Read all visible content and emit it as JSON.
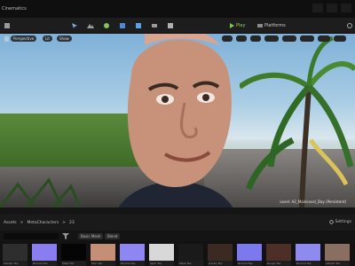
{
  "window": {
    "title": "Cinematics"
  },
  "toolbar": {
    "play_label": "Play",
    "platforms_label": "Platforms"
  },
  "viewport": {
    "perspective_label": "Perspective",
    "lit_label": "Lit",
    "show_label": "Show",
    "level_label": "Level: A2_MainLevel_Day (Persistent)"
  },
  "content_browser": {
    "breadcrumbs": [
      "Assets",
      ">",
      "MetaCharacters",
      ">",
      "23"
    ],
    "settings_label": "Settings",
    "filter_label": "Basic Mesh",
    "filter2_label": "Blend"
  },
  "asset_tiles": [
    {
      "label": "Shader Tex",
      "color": "#2e2e2e"
    },
    {
      "label": "Normal Tex",
      "color": "#8a7df0"
    },
    {
      "label": "Mask Tex",
      "color": "#050505"
    },
    {
      "label": "Skin Tex",
      "color": "#c58e77"
    },
    {
      "label": "Normal Tex",
      "color": "#8e86f2"
    },
    {
      "label": "Spec Tex",
      "color": "#d8d8d8"
    },
    {
      "label": "Mask Tex",
      "color": "#1a1a1a"
    },
    {
      "label": "Cavity Tex",
      "color": "#3a2a22"
    },
    {
      "label": "Normal Tex",
      "color": "#7c79ee"
    },
    {
      "label": "Rough Tex",
      "color": "#4d2f28"
    },
    {
      "label": "Normal Tex",
      "color": "#8f8af0"
    },
    {
      "label": "Albedo Tex",
      "color": "#8a6f60"
    }
  ]
}
